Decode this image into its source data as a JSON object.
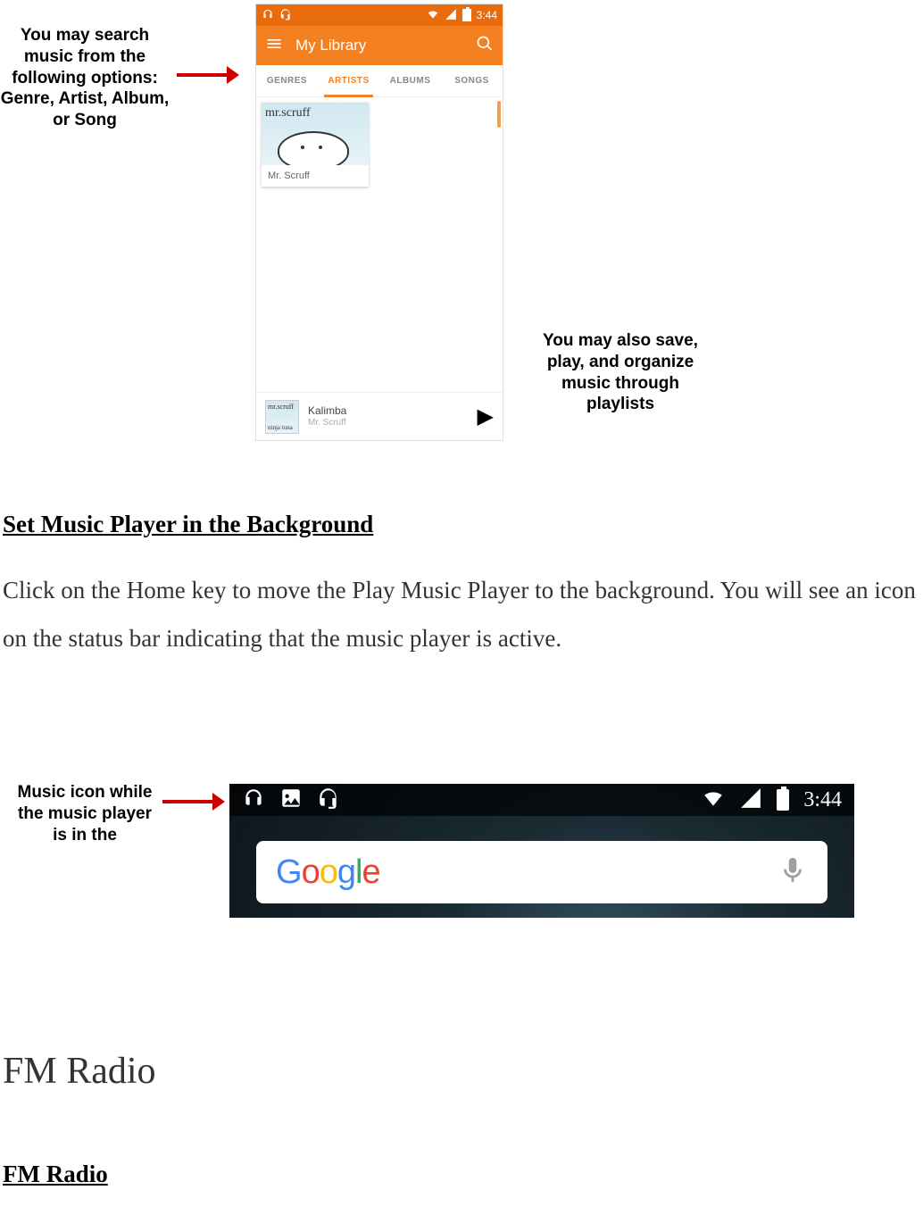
{
  "annotations": {
    "search_options": "You may search music from the following options: Genre, Artist, Album, or Song",
    "playlists": "You may also save, play, and organize music through playlists",
    "music_icon": "Music icon while the music player is in the"
  },
  "phone": {
    "status_time": "3:44",
    "appbar_title": "My Library",
    "tabs": {
      "genres": "GENRES",
      "artists": "ARTISTS",
      "albums": "ALBUMS",
      "songs": "SONGS"
    },
    "card": {
      "art_text": "mr.scruff",
      "label": "Mr. Scruff"
    },
    "nowplaying": {
      "art_line1": "mr.scruff",
      "art_line2": "ninja tuna",
      "title": "Kalimba",
      "artist": "Mr. Scruff"
    }
  },
  "body": {
    "heading1": "Set Music Player in the Background",
    "para1": "Click on the Home key to move the Play Music Player to the background. You will see an icon on the status bar indicating that the music player is active."
  },
  "homescreen": {
    "time": "3:44",
    "search_brand": "Google"
  },
  "section_large": "FM Radio",
  "section_sub": "FM Radio"
}
